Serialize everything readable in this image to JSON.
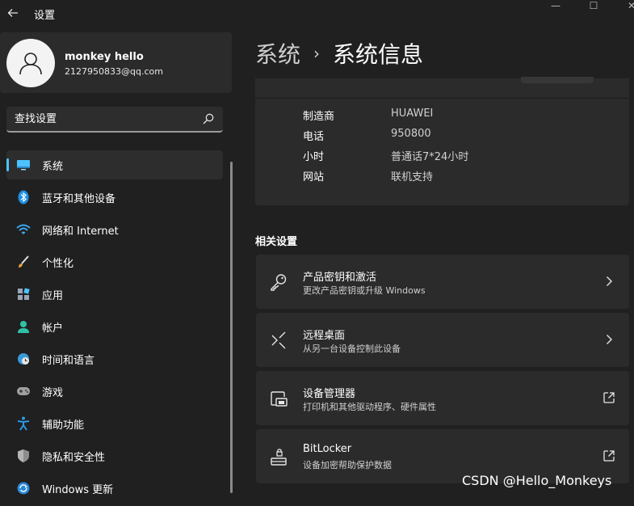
{
  "window": {
    "title": "设置",
    "minimize_glyph": "—",
    "maximize_glyph": "☐",
    "close_glyph": "✕"
  },
  "profile": {
    "name": "monkey hello",
    "email": "2127950833@qq.com"
  },
  "search": {
    "placeholder": "查找设置"
  },
  "nav": {
    "items": [
      {
        "label": "系统",
        "icon": "system-icon",
        "active": true
      },
      {
        "label": "蓝牙和其他设备",
        "icon": "bluetooth-icon"
      },
      {
        "label": "网络和 Internet",
        "icon": "wifi-icon"
      },
      {
        "label": "个性化",
        "icon": "brush-icon"
      },
      {
        "label": "应用",
        "icon": "apps-icon"
      },
      {
        "label": "帐户",
        "icon": "account-icon"
      },
      {
        "label": "时间和语言",
        "icon": "globe-clock-icon"
      },
      {
        "label": "游戏",
        "icon": "gamepad-icon"
      },
      {
        "label": "辅助功能",
        "icon": "accessibility-icon"
      },
      {
        "label": "隐私和安全性",
        "icon": "shield-icon"
      },
      {
        "label": "Windows 更新",
        "icon": "update-icon"
      }
    ]
  },
  "breadcrumb": {
    "parent": "系统",
    "separator": "›",
    "current": "系统信息"
  },
  "support_info": {
    "rows": [
      {
        "key": "制造商",
        "value": "HUAWEI"
      },
      {
        "key": "电话",
        "value": "950800"
      },
      {
        "key": "小时",
        "value": "普通话7*24小时"
      },
      {
        "key": "网站",
        "value": "联机支持"
      }
    ]
  },
  "related": {
    "title": "相关设置",
    "items": [
      {
        "title": "产品密钥和激活",
        "subtitle": "更改产品密钥或升级 Windows",
        "icon": "key-icon",
        "action": "chevron-right-icon"
      },
      {
        "title": "远程桌面",
        "subtitle": "从另一台设备控制此设备",
        "icon": "remote-desktop-icon",
        "action": "chevron-right-icon"
      },
      {
        "title": "设备管理器",
        "subtitle": "打印机和其他驱动程序、硬件属性",
        "icon": "device-manager-icon",
        "action": "external-link-icon"
      },
      {
        "title": "BitLocker",
        "subtitle": "设备加密帮助保护数据",
        "icon": "lock-drive-icon",
        "action": "external-link-icon"
      }
    ]
  },
  "watermark": "CSDN @Hello_Monkeys",
  "colors": {
    "background": "#202020",
    "card": "#2b2b2b",
    "accent": "#4cc2ff"
  }
}
